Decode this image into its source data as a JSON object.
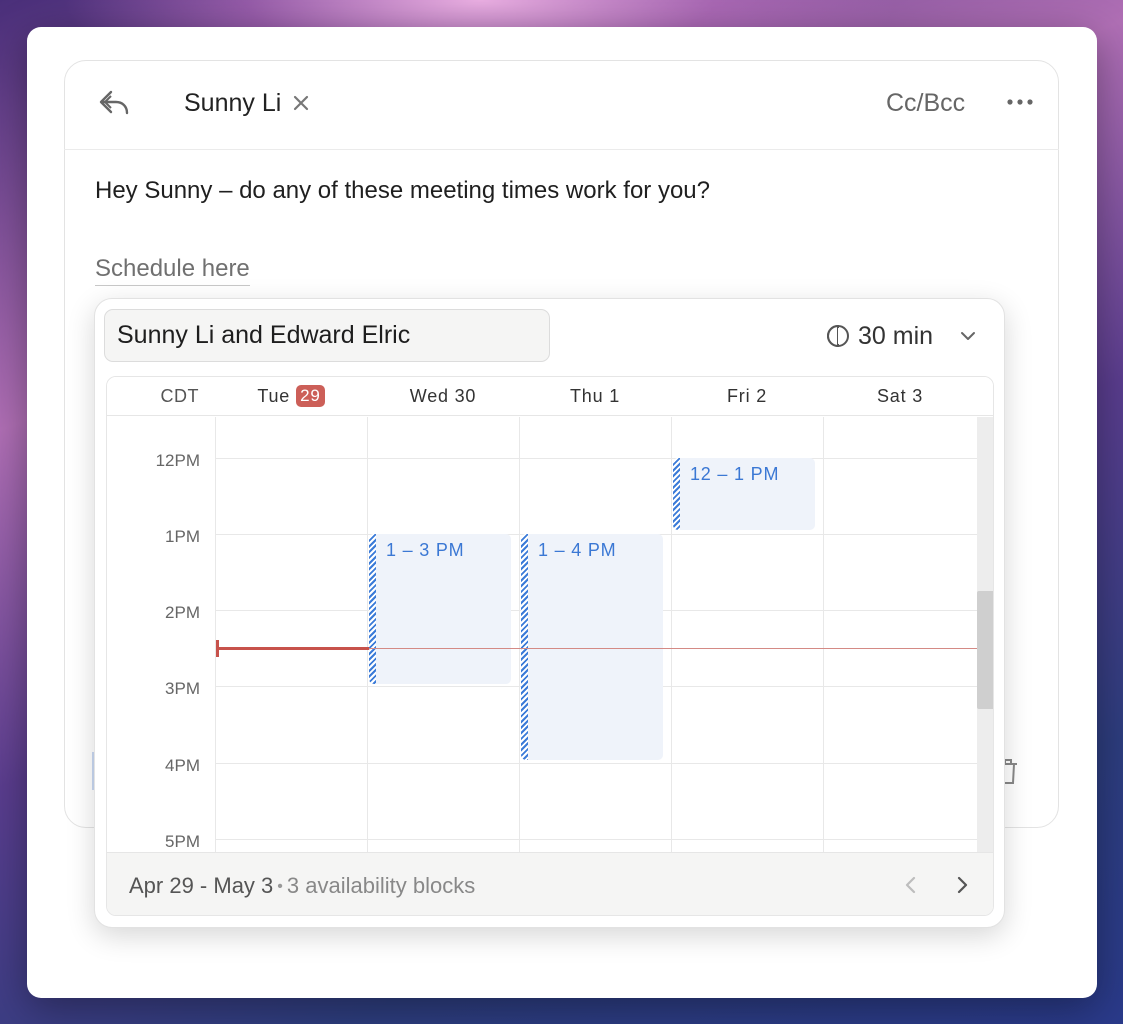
{
  "header": {
    "recipient": "Sunny Li",
    "cc_bcc_label": "Cc/Bcc"
  },
  "body": {
    "message": "Hey Sunny – do any of these meeting times work for you?",
    "schedule_link": "Schedule here"
  },
  "scheduler": {
    "title_value": "Sunny Li and Edward Elric",
    "duration": "30 min",
    "timezone": "CDT",
    "days": [
      {
        "label": "Tue",
        "badge": "29",
        "today": true
      },
      {
        "label": "Wed 30"
      },
      {
        "label": "Thu 1"
      },
      {
        "label": "Fri 2"
      },
      {
        "label": "Sat 3"
      }
    ],
    "hours": [
      "12PM",
      "1PM",
      "2PM",
      "3PM",
      "4PM",
      "5PM"
    ],
    "blocks": [
      {
        "day": "Wed 30",
        "label": "1 – 3 PM"
      },
      {
        "day": "Thu 1",
        "label": "1 – 4 PM"
      },
      {
        "day": "Fri 2",
        "label": "12 – 1 PM"
      }
    ],
    "footer": {
      "range": "Apr 29 - May 3",
      "separator": "•",
      "count": "3 availability blocks"
    }
  },
  "colors": {
    "accent_blue": "#3b78d4",
    "today_red": "#cc5f58",
    "block_bg": "#eff3fa"
  }
}
